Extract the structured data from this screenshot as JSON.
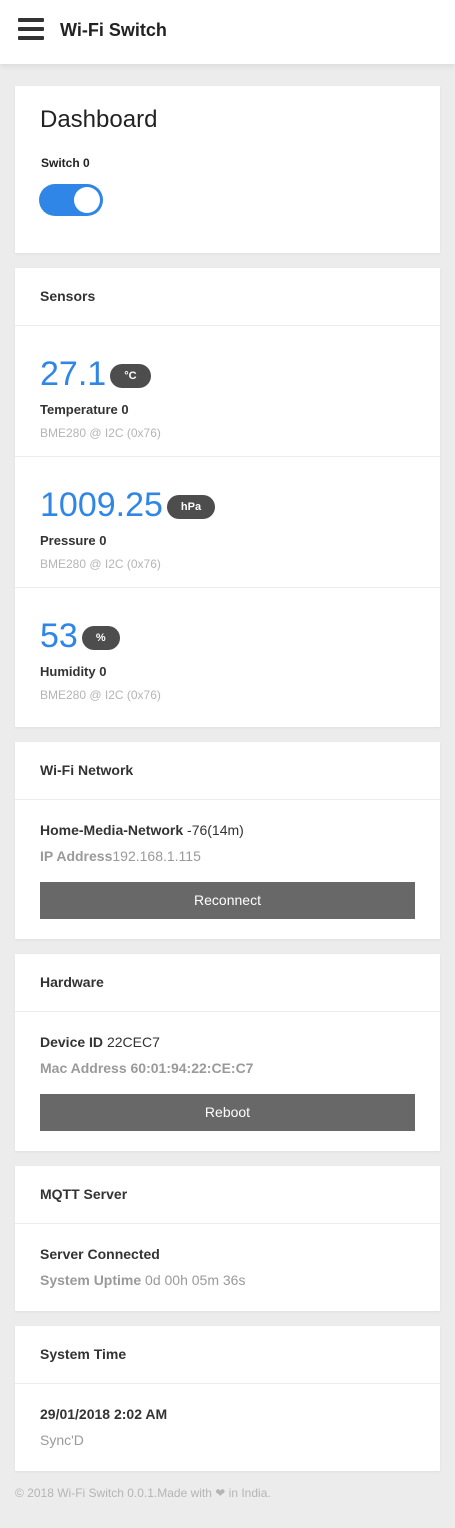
{
  "header": {
    "menu_icon": "hamburger-menu-icon",
    "title": "Wi-Fi Switch"
  },
  "dashboard": {
    "title": "Dashboard",
    "switch_label": "Switch 0",
    "switch_on": true,
    "switch_color": "#2f86e6"
  },
  "sensors": {
    "title": "Sensors",
    "items": [
      {
        "value": "27.1",
        "unit": "°C",
        "name": "Temperature 0",
        "source": "BME280 @ I2C (0x76)"
      },
      {
        "value": "1009.25",
        "unit": "hPa",
        "name": "Pressure 0",
        "source": "BME280 @ I2C (0x76)"
      },
      {
        "value": "53",
        "unit": "%",
        "name": "Humidity 0",
        "source": "BME280 @ I2C (0x76)"
      }
    ]
  },
  "wifi": {
    "title": "Wi-Fi Network",
    "ssid": "Home-Media-Network",
    "signal": "-76(14m)",
    "ip_label": "IP Address",
    "ip_value": "192.168.1.115",
    "button": "Reconnect"
  },
  "hardware": {
    "title": "Hardware",
    "device_id_label": "Device ID",
    "device_id_value": "22CEC7",
    "mac_label": "Mac Address",
    "mac_value": "60:01:94:22:CE:C7",
    "button": "Reboot"
  },
  "mqtt": {
    "title": "MQTT Server",
    "status": "Server Connected",
    "uptime_label": "System Uptime",
    "uptime_value": "0d 00h 05m 36s"
  },
  "system_time": {
    "title": "System Time",
    "datetime": "29/01/2018 2:02 AM",
    "sync_status": "Sync'D"
  },
  "footer": {
    "before_heart": "© 2018 Wi-Fi Switch 0.0.1.Made with",
    "heart_icon": "heart-icon",
    "after_heart": "in India."
  },
  "colors": {
    "accent": "#2f86e6",
    "badge": "#4d4d4d",
    "button": "#686868",
    "background": "#ececec"
  }
}
